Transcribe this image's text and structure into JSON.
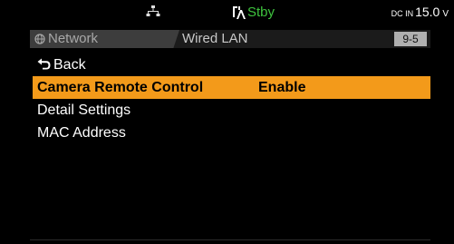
{
  "status": {
    "network_icon": "network-tree-icon",
    "record_icon": "card-record-icon",
    "stby_text": "Stby",
    "stby_color": "#3ec33e",
    "power_label": "DC IN",
    "power_value": "15.0",
    "power_unit": "V"
  },
  "header": {
    "parent_icon": "globe-icon",
    "parent_label": "Network",
    "current_label": "Wired LAN",
    "page_badge": "9-5"
  },
  "menu": {
    "back_label": "Back",
    "items": [
      {
        "label": "Camera Remote Control",
        "value": "Enable",
        "selected": true
      },
      {
        "label": "Detail Settings",
        "value": "",
        "selected": false
      },
      {
        "label": "MAC Address",
        "value": "",
        "selected": false
      }
    ]
  },
  "colors": {
    "selection": "#f39a1a",
    "background": "#000000",
    "header_left": "#3d3d3d",
    "badge": "#b0b0b0"
  }
}
